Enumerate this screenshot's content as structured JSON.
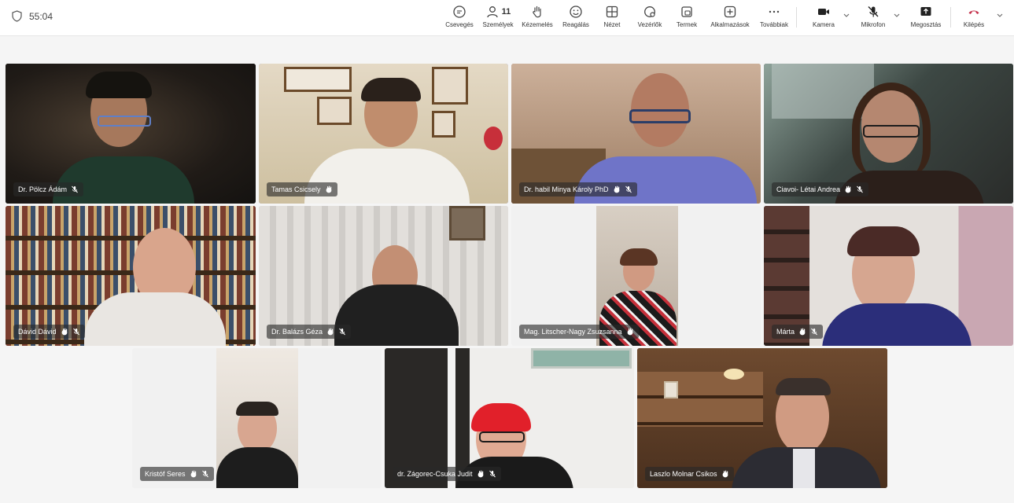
{
  "meeting": {
    "timer": "55:04"
  },
  "toolbar": {
    "chat": "Csevegés",
    "people": "Személyek",
    "people_count": "11",
    "raise": "Kézemelés",
    "react": "Reagálás",
    "view": "Nézet",
    "controls": "Vezérlők",
    "rooms": "Termek",
    "apps": "Alkalmazások",
    "more": "Továbbiak",
    "camera": "Kamera",
    "mic": "Mikrofon",
    "share": "Megosztás",
    "leave": "Kilépés",
    "leave_color": "#c4314b"
  },
  "participants": [
    {
      "name": "Dr. Pölcz Ádám",
      "muted": true,
      "hand": false
    },
    {
      "name": "Tamas Csicsely",
      "muted": false,
      "hand": true
    },
    {
      "name": "Dr. habil Minya Károly PhD",
      "muted": true,
      "hand": true
    },
    {
      "name": "Ciavoi- Létai Andrea",
      "muted": true,
      "hand": true
    },
    {
      "name": "Dávid Dávid",
      "muted": true,
      "hand": true
    },
    {
      "name": "Dr. Balázs Géza",
      "muted": true,
      "hand": true
    },
    {
      "name": "Mag. Litscher-Nagy Zsuzsanna",
      "muted": false,
      "hand": true
    },
    {
      "name": "Márta",
      "muted": true,
      "hand": true
    },
    {
      "name": "Kristóf Seres",
      "muted": true,
      "hand": true
    },
    {
      "name": "dr. Zágorec-Csuka Judit",
      "muted": true,
      "hand": true
    },
    {
      "name": "Laszlo Molnar Csikos",
      "muted": false,
      "hand": true
    }
  ],
  "colors": {
    "active_speaker": "#7b83eb",
    "tag_background": "#282828"
  }
}
